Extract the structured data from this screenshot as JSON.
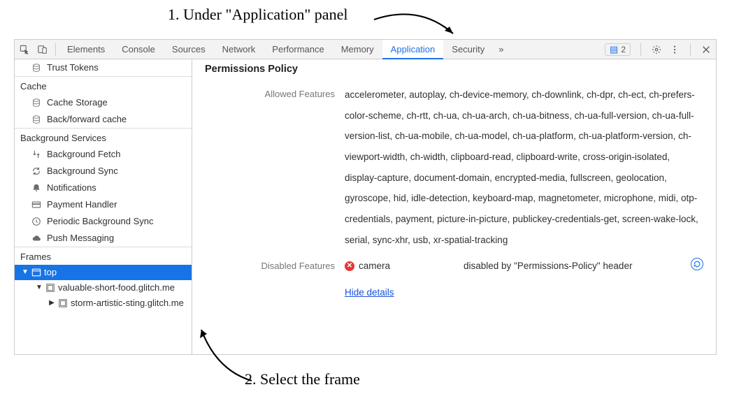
{
  "annotations": {
    "top": "1. Under \"Application\" panel",
    "bottom": "2. Select the frame"
  },
  "tabbar": {
    "tabs": [
      "Elements",
      "Console",
      "Sources",
      "Network",
      "Performance",
      "Memory",
      "Application",
      "Security"
    ],
    "active": "Application",
    "more": "»",
    "badge_count": "2"
  },
  "sidebar": {
    "first_item": "Trust Tokens",
    "cache": {
      "title": "Cache",
      "items": [
        "Cache Storage",
        "Back/forward cache"
      ]
    },
    "bgservices": {
      "title": "Background Services",
      "items": [
        "Background Fetch",
        "Background Sync",
        "Notifications",
        "Payment Handler",
        "Periodic Background Sync",
        "Push Messaging"
      ]
    },
    "frames": {
      "title": "Frames",
      "top": "top",
      "child": "valuable-short-food.glitch.me",
      "grand": "storm-artistic-sting.glitch.me"
    }
  },
  "main": {
    "title": "Permissions Policy",
    "allowed_label": "Allowed Features",
    "allowed_value": "accelerometer, autoplay, ch-device-memory, ch-downlink, ch-dpr, ch-ect, ch-prefers-color-scheme, ch-rtt, ch-ua, ch-ua-arch, ch-ua-bitness, ch-ua-full-version, ch-ua-full-version-list, ch-ua-mobile, ch-ua-model, ch-ua-platform, ch-ua-platform-version, ch-viewport-width, ch-width, clipboard-read, clipboard-write, cross-origin-isolated, display-capture, document-domain, encrypted-media, fullscreen, geolocation, gyroscope, hid, idle-detection, keyboard-map, magnetometer, microphone, midi, otp-credentials, payment, picture-in-picture, publickey-credentials-get, screen-wake-lock, serial, sync-xhr, usb, xr-spatial-tracking",
    "disabled_label": "Disabled Features",
    "disabled_feature": "camera",
    "disabled_reason": "disabled by \"Permissions-Policy\" header",
    "hide_details": "Hide details"
  }
}
